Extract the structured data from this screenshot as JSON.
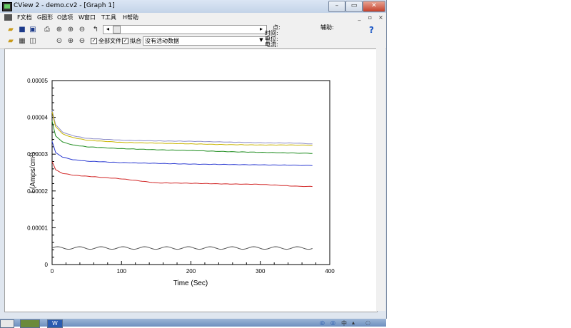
{
  "window": {
    "title": "CView 2 - demo.cv2 - [Graph 1]",
    "controls": {
      "minimize": "–",
      "restore": "▭",
      "close": "✕"
    }
  },
  "menu": {
    "items": [
      "F文档",
      "G图形",
      "O选项",
      "W窗口",
      "T工具",
      "H帮助"
    ],
    "mdi": {
      "minimize": "_",
      "restore": "▫",
      "close": "×"
    }
  },
  "toolbar": {
    "icons": [
      "open-folder-icon",
      "save-icon",
      "save-as-icon",
      "print-icon",
      "zoom-fit-icon",
      "zoom-in-icon",
      "zoom-out-icon",
      "cursor-icon",
      "folder-open-icon",
      "table-icon",
      "graph-icon",
      "magnify-icon",
      "magnify-plus-icon",
      "magnify-minus-icon",
      "checkbox-cursor-icon"
    ],
    "all_files_label": "全部文件",
    "all_files_checked": true,
    "fit_label": "拟合",
    "fit_checked": true,
    "active_data_select": "没有活动数据",
    "info_labels": [
      "点:",
      "时间:",
      "电位:",
      "电流:"
    ],
    "assist_label": "辅助:",
    "help_symbol": "?"
  },
  "chart_data": {
    "type": "line",
    "xlabel": "Time (Sec)",
    "ylabel": "I (Amps/cm²)",
    "xlim": [
      0,
      400
    ],
    "ylim": [
      0,
      5e-05
    ],
    "x_ticks": [
      "0",
      "100",
      "200",
      "300",
      "400"
    ],
    "y_ticks": [
      "0",
      "0.00001",
      "0.00002",
      "0.00003",
      "0.00004",
      "0.00005"
    ],
    "grid": false,
    "series": [
      {
        "color": "#8c8cc8",
        "x": [
          0,
          5,
          15,
          30,
          50,
          100,
          150,
          200,
          250,
          300,
          350,
          375
        ],
        "y": [
          4.2e-05,
          3.8e-05,
          3.6e-05,
          3.5e-05,
          3.43e-05,
          3.38e-05,
          3.36e-05,
          3.35e-05,
          3.33e-05,
          3.31e-05,
          3.3e-05,
          3.28e-05
        ]
      },
      {
        "color": "#c8b400",
        "x": [
          0,
          5,
          15,
          30,
          50,
          100,
          150,
          200,
          250,
          300,
          350,
          375
        ],
        "y": [
          4.15e-05,
          3.75e-05,
          3.55e-05,
          3.45e-05,
          3.38e-05,
          3.32e-05,
          3.3e-05,
          3.28e-05,
          3.26e-05,
          3.25e-05,
          3.25e-05,
          3.24e-05
        ]
      },
      {
        "color": "#1e8c1e",
        "x": [
          0,
          5,
          15,
          30,
          50,
          100,
          150,
          200,
          250,
          300,
          350,
          375
        ],
        "y": [
          3.9e-05,
          3.5e-05,
          3.33e-05,
          3.25e-05,
          3.2e-05,
          3.15e-05,
          3.12e-05,
          3.1e-05,
          3.07e-05,
          3.05e-05,
          3.03e-05,
          3.02e-05
        ]
      },
      {
        "color": "#2d3cd2",
        "x": [
          0,
          5,
          15,
          30,
          50,
          100,
          150,
          200,
          250,
          300,
          350,
          375
        ],
        "y": [
          3.35e-05,
          3.05e-05,
          2.92e-05,
          2.85e-05,
          2.81e-05,
          2.77e-05,
          2.75e-05,
          2.73e-05,
          2.72e-05,
          2.71e-05,
          2.7e-05,
          2.69e-05
        ]
      },
      {
        "color": "#d22828",
        "x": [
          0,
          5,
          15,
          30,
          50,
          100,
          150,
          200,
          250,
          300,
          350,
          375
        ],
        "y": [
          2.8e-05,
          2.58e-05,
          2.48e-05,
          2.43e-05,
          2.4e-05,
          2.33e-05,
          2.22e-05,
          2.21e-05,
          2.19e-05,
          2.18e-05,
          2.13e-05,
          2.12e-05
        ]
      },
      {
        "color": "#555555",
        "x": [
          0,
          375
        ],
        "y": [
          4.5e-06,
          4.5e-06
        ],
        "wavy": true
      }
    ]
  },
  "taskbar": {
    "tray_text": "中"
  }
}
